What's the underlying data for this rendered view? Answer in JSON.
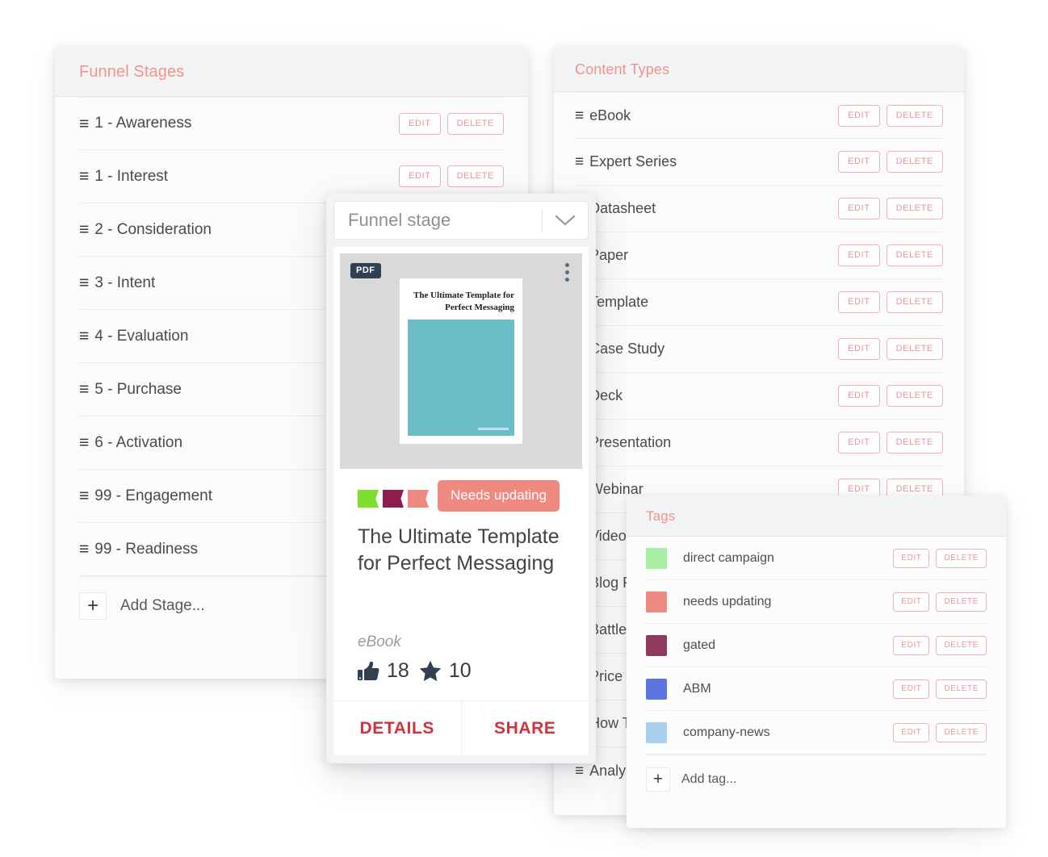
{
  "funnel_panel": {
    "title": "Funnel Stages",
    "rows": [
      {
        "label": "1 - Awareness"
      },
      {
        "label": "1 - Interest"
      },
      {
        "label": "2 - Consideration"
      },
      {
        "label": "3 - Intent"
      },
      {
        "label": "4 - Evaluation"
      },
      {
        "label": "5 - Purchase"
      },
      {
        "label": "6 - Activation"
      },
      {
        "label": "99 - Engagement"
      },
      {
        "label": "99 - Readiness"
      }
    ],
    "add_label": "Add Stage...",
    "edit_label": "EDIT",
    "delete_label": "DELETE",
    "plus_icon": "+",
    "grip_icon": "≡"
  },
  "content_panel": {
    "title": "Content Types",
    "rows": [
      {
        "label": "eBook"
      },
      {
        "label": "Expert Series"
      },
      {
        "label": "Datasheet"
      },
      {
        "label": "Paper"
      },
      {
        "label": "Template"
      },
      {
        "label": "Case Study"
      },
      {
        "label": "Deck"
      },
      {
        "label": "Presentation"
      },
      {
        "label": "Webinar"
      },
      {
        "label": "Video"
      },
      {
        "label": "Blog Post"
      },
      {
        "label": "Battlecard"
      },
      {
        "label": "Price List"
      },
      {
        "label": "How To"
      },
      {
        "label": "Analyst Report"
      }
    ],
    "edit_label": "EDIT",
    "delete_label": "DELETE",
    "grip_icon": "≡"
  },
  "tags_panel": {
    "title": "Tags",
    "rows": [
      {
        "label": "direct campaign",
        "color": "#a8eda4"
      },
      {
        "label": "needs updating",
        "color": "#ee8a80"
      },
      {
        "label": "gated",
        "color": "#8e3a5f"
      },
      {
        "label": "ABM",
        "color": "#5b77df"
      },
      {
        "label": "company-news",
        "color": "#a9cfee"
      }
    ],
    "add_label": "Add tag...",
    "edit_label": "EDIT",
    "delete_label": "DELETE",
    "plus_icon": "+"
  },
  "content_card": {
    "select_value": "Funnel stage",
    "caret_icon": "chevron-down-icon",
    "file_badge": "PDF",
    "kebab_icon": "more-vertical-icon",
    "doc_preview_title": "The Ultimate Template for Perfect Messaging",
    "ribbon_tags": [
      {
        "color": "#7ee02e"
      },
      {
        "color": "#8e1c4d"
      },
      {
        "color": "#ee8a80"
      }
    ],
    "status_badge": "Needs updating",
    "status_badge_color": "#ee8a80",
    "title": "The Ultimate Template for Perfect Messaging",
    "kind": "eBook",
    "likes": "18",
    "stars": "10",
    "details_label": "DETAILS",
    "share_label": "SHARE"
  },
  "theme": {
    "accent_pink": "#f2938c",
    "action_red": "#d3313c",
    "btn_border": "#eeb3b6",
    "doc_teal": "#6dbdc9",
    "pdf_navy": "#2e4052"
  }
}
